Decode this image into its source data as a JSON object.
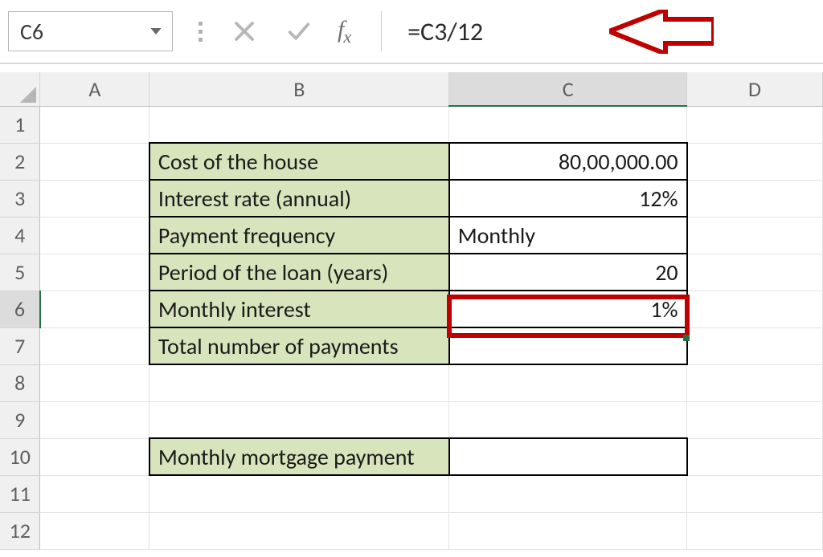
{
  "namebox": {
    "value": "C6"
  },
  "formula": "=C3/12",
  "columns": [
    "A",
    "B",
    "C",
    "D"
  ],
  "active_col": "C",
  "active_row": "6",
  "rows": [
    "1",
    "2",
    "3",
    "4",
    "5",
    "6",
    "7",
    "8",
    "9",
    "10",
    "11",
    "12"
  ],
  "cells": {
    "b2": "Cost of the house",
    "c2": "80,00,000.00",
    "b3": "Interest rate (annual)",
    "c3": "12%",
    "b4": "Payment frequency",
    "c4": "Monthly",
    "b5": "Period of the loan (years)",
    "c5": "20",
    "b6": "Monthly interest",
    "c6": "1%",
    "b7": "Total number of payments",
    "b10": "Monthly mortgage payment"
  }
}
